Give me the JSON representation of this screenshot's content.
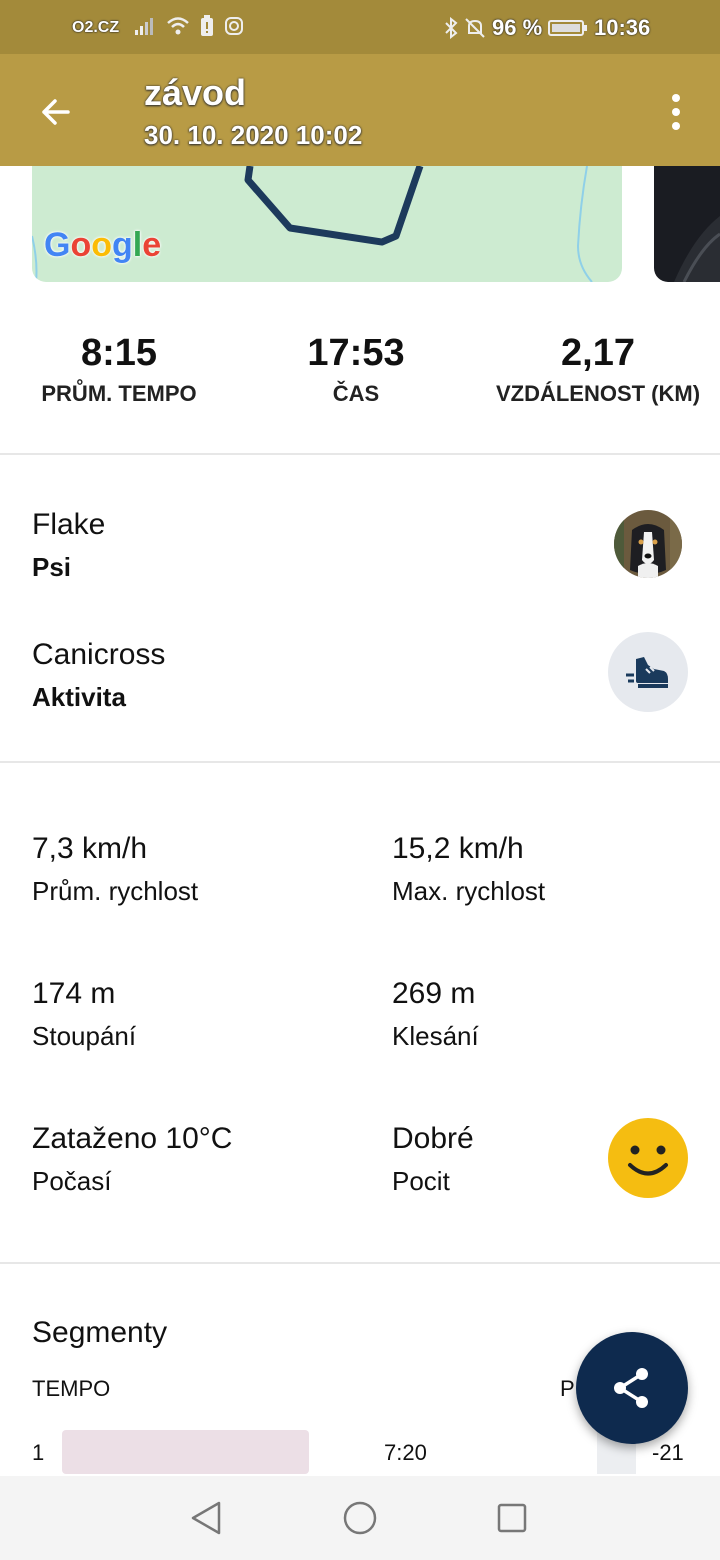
{
  "status_bar": {
    "carrier": "O2.CZ",
    "battery_percent": "96 %",
    "time": "10:36",
    "icons": [
      "signal-icon",
      "wifi-icon",
      "battery-alert-icon",
      "instagram-icon",
      "bluetooth-icon",
      "mute-icon",
      "battery-icon"
    ]
  },
  "app_bar": {
    "title": "závod",
    "subtitle": "30. 10. 2020 10:02",
    "colors": {
      "background": "#b89b45",
      "status_background": "#a38a3a"
    }
  },
  "map": {
    "google_logo": {
      "G": "G",
      "o1": "o",
      "o2": "o",
      "g": "g",
      "l": "l",
      "e": "e"
    }
  },
  "summary": [
    {
      "value": "8:15",
      "label": "PRŮM. TEMPO"
    },
    {
      "value": "17:53",
      "label": "ČAS"
    },
    {
      "value": "2,17",
      "label": "VZDÁLENOST (KM)"
    }
  ],
  "dog": {
    "name": "Flake",
    "label": "Psi"
  },
  "activity": {
    "name": "Canicross",
    "label": "Aktivita"
  },
  "metrics": {
    "avg_speed": {
      "value": "7,3 km/h",
      "label": "Prům. rychlost"
    },
    "max_speed": {
      "value": "15,2 km/h",
      "label": "Max. rychlost"
    },
    "ascent": {
      "value": "174 m",
      "label": "Stoupání"
    },
    "descent": {
      "value": "269 m",
      "label": "Klesání"
    },
    "weather": {
      "value": "Zataženo 10°C",
      "label": "Počasí"
    },
    "feeling": {
      "value": "Dobré",
      "label": "Pocit"
    }
  },
  "segments": {
    "title": "Segmenty",
    "col_tempo": "TEMPO",
    "col_elev": "P",
    "rows": [
      {
        "index": "1",
        "time": "7:20",
        "elev": "-21"
      }
    ]
  },
  "colors": {
    "fab": "#0e2a4e",
    "smiley": "#f5bd11",
    "route": "#1d3a5c"
  }
}
